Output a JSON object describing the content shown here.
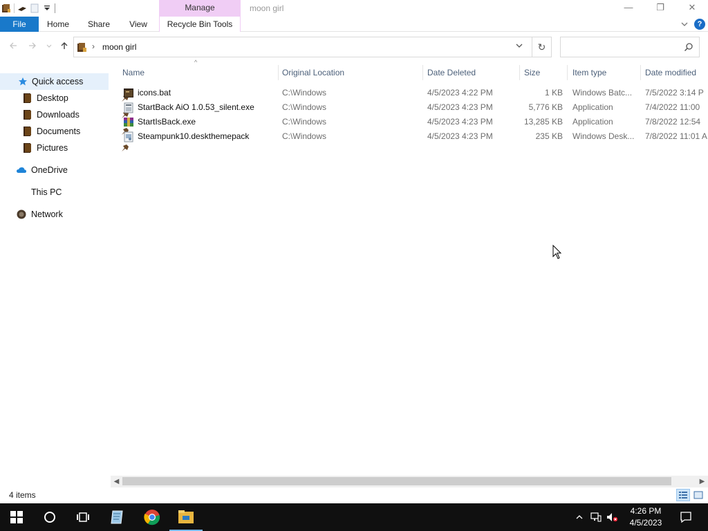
{
  "window": {
    "title": "moon girl",
    "contextual_group": "Manage",
    "controls": {
      "minimize": "—",
      "maximize": "❐",
      "close": "✕"
    }
  },
  "ribbon": {
    "tabs": [
      "File",
      "Home",
      "Share",
      "View",
      "Recycle Bin Tools"
    ],
    "expand_icon": "chevron-down-icon",
    "help": "?"
  },
  "address": {
    "path": "moon girl",
    "separator": "›",
    "dropdown": "⌄",
    "refresh": "↻",
    "search_placeholder": ""
  },
  "nav_pane": {
    "quick_access": "Quick access",
    "pinned": [
      "Desktop",
      "Downloads",
      "Documents",
      "Pictures"
    ],
    "onedrive": "OneDrive",
    "this_pc": "This PC",
    "network": "Network"
  },
  "columns": [
    "Name",
    "Original Location",
    "Date Deleted",
    "Size",
    "Item type",
    "Date modified"
  ],
  "files": [
    {
      "name": "icons.bat",
      "location": "C:\\Windows",
      "deleted": "4/5/2023 4:22 PM",
      "size": "1 KB",
      "type": "Windows Batc...",
      "modified": "7/5/2022 3:14 P",
      "icon": "batch-file-icon"
    },
    {
      "name": "StartBack AiO 1.0.53_silent.exe",
      "location": "C:\\Windows",
      "deleted": "4/5/2023 4:23 PM",
      "size": "5,776 KB",
      "type": "Application",
      "modified": "7/4/2022 11:00",
      "icon": "exe-file-icon"
    },
    {
      "name": "StartIsBack.exe",
      "location": "C:\\Windows",
      "deleted": "4/5/2023 4:23 PM",
      "size": "13,285 KB",
      "type": "Application",
      "modified": "7/8/2022 12:54",
      "icon": "archive-exe-icon"
    },
    {
      "name": "Steampunk10.deskthemepack",
      "location": "C:\\Windows",
      "deleted": "4/5/2023 4:23 PM",
      "size": "235 KB",
      "type": "Windows Desk...",
      "modified": "7/8/2022 11:01 A",
      "icon": "themepack-file-icon"
    }
  ],
  "status": {
    "item_count": "4 items"
  },
  "taskbar": {
    "time": "4:26 PM",
    "date": "4/5/2023",
    "tray_chevron": "^"
  },
  "colors": {
    "file_tab": "#1979ca",
    "manage_tab": "#f0cdf5",
    "selected_nav": "#e5f0fb",
    "taskbar": "#101010",
    "header_text": "#4c607a"
  }
}
